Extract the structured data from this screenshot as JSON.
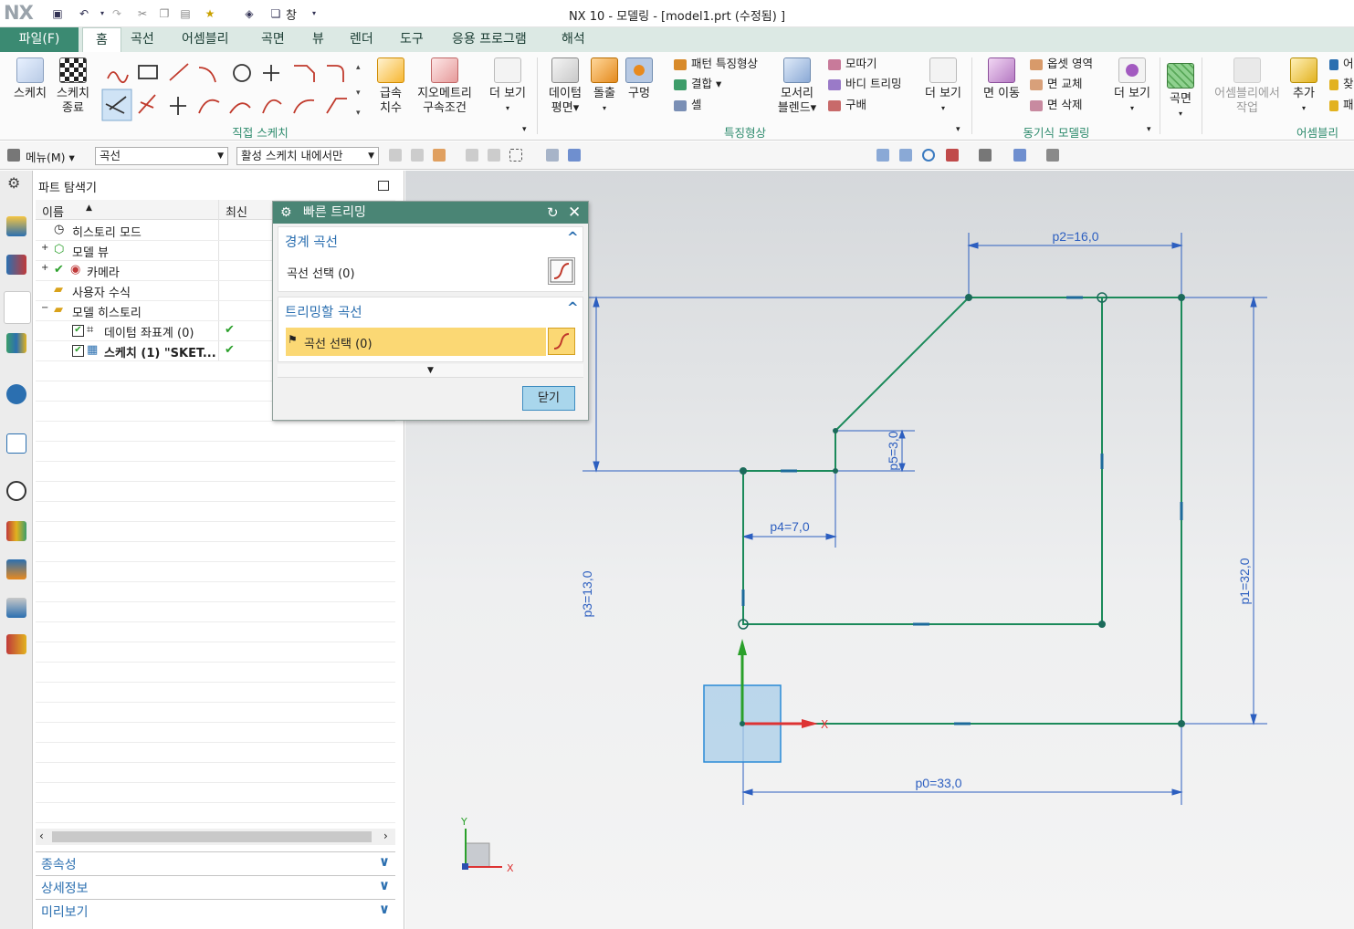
{
  "app": {
    "logo": "NX",
    "title": "NX 10 - 모델링 - [model1.prt (수정됨) ]",
    "window_menu": "창"
  },
  "tabs": [
    "파일(F)",
    "홈",
    "곡선",
    "어셈블리",
    "곡면",
    "뷰",
    "렌더",
    "도구",
    "응용 프로그램",
    "해석"
  ],
  "ribbon": {
    "sketch": "스케치",
    "finish_sketch_1": "스케치",
    "finish_sketch_2": "종료",
    "direct_sketch_group": "직접 스케치",
    "rapid_dim_1": "급속",
    "rapid_dim_2": "치수",
    "geom_con_1": "지오메트리",
    "geom_con_2": "구속조건",
    "more1": "더 보기",
    "datum_1": "데이텀",
    "datum_2": "평면",
    "extrude": "돌출",
    "hole": "구멍",
    "pattern_feature": "패턴 특징형상",
    "unite": "결합",
    "shell": "셸",
    "edge_blend_1": "모서리",
    "edge_blend_2": "블렌드",
    "chamfer": "모따기",
    "trim_body": "바디 트리밍",
    "draft": "구배",
    "more2": "더 보기",
    "feature_group": "특징형상",
    "move_face": "면 이동",
    "offset_region": "옵셋 영역",
    "replace_face": "면 교체",
    "delete_face": "면 삭제",
    "more3": "더 보기",
    "sync_group": "동기식 모델링",
    "surface": "곡면",
    "work_in_assy_1": "어셈블리에서",
    "work_in_assy_2": "작업",
    "add": "추가",
    "assy_group": "어셈블리",
    "cut1": "어",
    "cut2": "찾",
    "cut3": "패"
  },
  "toolbar2": {
    "menu": "메뉴(M)",
    "filter": "곡선",
    "scope": "활성 스케치 내에서만"
  },
  "navigator": {
    "title": "파트 탐색기",
    "col_name": "이름",
    "col_latest": "최신",
    "items": [
      {
        "label": "히스토리 모드",
        "latest": ""
      },
      {
        "label": "모델 뷰",
        "latest": ""
      },
      {
        "label": "카메라",
        "latest": ""
      },
      {
        "label": "사용자 수식",
        "latest": ""
      },
      {
        "label": "모델 히스토리",
        "latest": ""
      },
      {
        "label": "데이텀 좌표계 (0)",
        "latest": "✔"
      },
      {
        "label": "스케치 (1) \"SKET...",
        "latest": "✔"
      }
    ],
    "panels": [
      "종속성",
      "상세정보",
      "미리보기"
    ]
  },
  "dialog": {
    "title": "빠른 트리밍",
    "sec1_title": "경계 곡선",
    "sec1_select": "곡선 선택 (0)",
    "sec2_title": "트리밍할 곡선",
    "sec2_select": "곡선 선택 (0)",
    "close": "닫기"
  },
  "sketch": {
    "dims": {
      "p0": "p0=33,0",
      "p1": "p1=32,0",
      "p2": "p2=16,0",
      "p3": "p3=13,0",
      "p4": "p4=7,0",
      "p5": "p5=3,0"
    },
    "axis_x": "X",
    "axis_y": "Y",
    "triad_x": "X",
    "triad_y": "Y"
  },
  "colors": {
    "sketch_curve": "#1b8a5a",
    "dimension": "#2d5fc0",
    "accent_green": "#3b8a72"
  }
}
